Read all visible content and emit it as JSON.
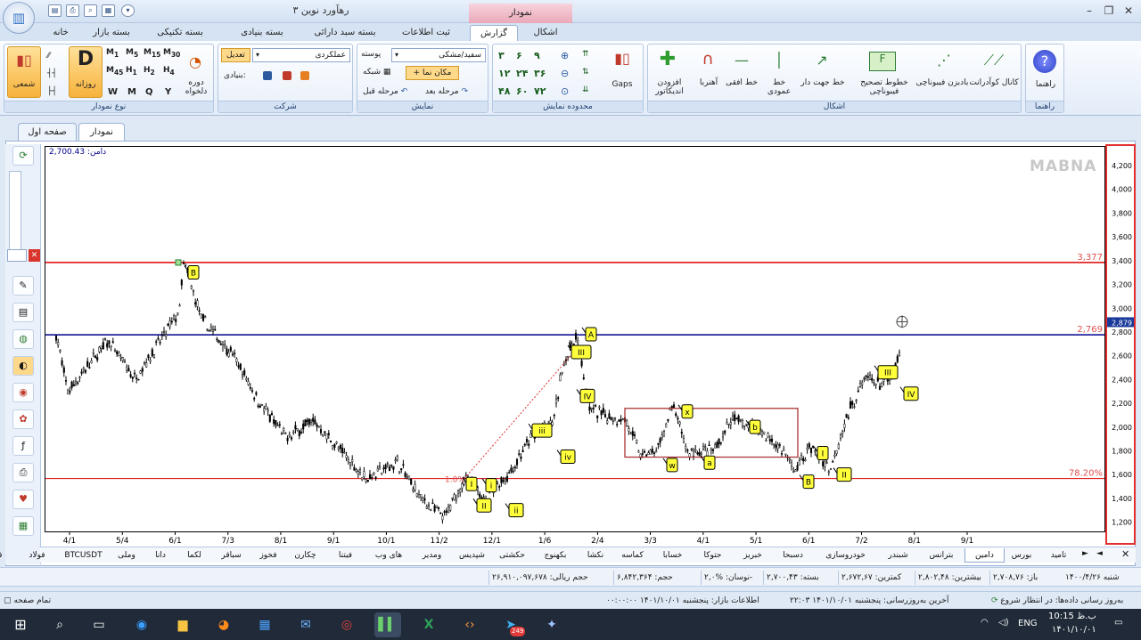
{
  "app": {
    "title": "رهآورد نوین ۳",
    "context_tab": "نمودار"
  },
  "ribbon_tabs": [
    "خانه",
    "بسته بازار",
    "بسته تکنیکی",
    "بسته بنیادی",
    "بسته سبد دارائی",
    "ثبت اطلاعات",
    "گزارش",
    "اشکال"
  ],
  "active_ribbon_tab": "گزارش",
  "groups": {
    "chart_type": {
      "label": "نوع نمودار",
      "candle": "شمعی",
      "daily": "روزانه",
      "daily_letter": "D",
      "periods": [
        "W",
        "M",
        "Q",
        "Y"
      ],
      "custom": "دوره دلخواه",
      "minutes": [
        "1",
        "5",
        "15",
        "30",
        "45",
        "1",
        "2",
        "4"
      ]
    },
    "company": {
      "label": "شرکت",
      "name": "عملکردی",
      "adjust": "تعدیل",
      "fundamental": "بنیادی:"
    },
    "display": {
      "label": "نمایش",
      "theme_label": "پوسته",
      "theme_value": "سفید/مشکی",
      "cursor": "مکان نما",
      "grid": "شبکه",
      "next": "مرحله بعد",
      "prev": "مرحله قبل"
    },
    "range": {
      "label": "محدوده نمایش",
      "gaps": "Gaps",
      "values": [
        "۳",
        "۶",
        "۹",
        "۱۲",
        "۲۴",
        "۳۶",
        "۴۸",
        "۶۰",
        "۷۲"
      ]
    },
    "shapes": {
      "label": "اشکال",
      "items": [
        "کانال کوآدرانت",
        "بادبزن فیبوناچی",
        "خطوط تصحیح فیبوناچی",
        "خط جهت دار",
        "خط عمودی",
        "خط افقی",
        "آهنربا",
        "افزودن اندیکاتور"
      ]
    },
    "help": {
      "label": "راهنما",
      "item": "راهنما"
    }
  },
  "doc_tabs": [
    "نمودار",
    "صفحه اول"
  ],
  "chart": {
    "watermark": "MABNA",
    "info_label": "دامن: 2,700.43",
    "price_lines": [
      {
        "value": 3377,
        "label": "3,377",
        "color": "#e00000"
      },
      {
        "value": 2769,
        "label": "2,769",
        "color": "#00008b"
      },
      {
        "value": 1560,
        "label": "78.20%",
        "color": "#e00000"
      }
    ],
    "fib_start_label": "1.0%",
    "current_price": "2,879",
    "y_ticks": [
      "4,200",
      "4,000",
      "3,800",
      "3,600",
      "3,400",
      "3,200",
      "3,000",
      "2,800",
      "2,600",
      "2,400",
      "2,200",
      "2,000",
      "1,800",
      "1,600",
      "1,400",
      "1,200"
    ],
    "x_ticks": [
      "4/1",
      "5/4",
      "6/1",
      "7/3",
      "8/1",
      "9/1",
      "10/1",
      "11/2",
      "12/1",
      "1/6",
      "2/4",
      "3/3",
      "4/1",
      "5/1",
      "6/1",
      "7/2",
      "8/1",
      "9/1"
    ],
    "y_range": [
      1100,
      4350
    ],
    "wave_labels": [
      "B",
      "A",
      "III",
      "IV",
      "iii",
      "iv",
      "I",
      "i",
      "ii",
      "II",
      "x",
      "w",
      "a",
      "b",
      "B",
      "I",
      "II",
      "III",
      "IV"
    ]
  },
  "symbol_tabs": [
    "تامید",
    "بورس",
    "دامین",
    "بترانس",
    "شبندر",
    "خودروسازی",
    "دسبحا",
    "خبریز",
    "حتوکا",
    "خسابا",
    "کماسه",
    "نکشا",
    "بکهنوج",
    "حکشتی",
    "شپدیس",
    "ومدیر",
    "های وب",
    "فیتنا",
    "چکارن",
    "فخوز",
    "سباقر",
    "لکما",
    "دانا",
    "وملی",
    "BTCUSDT",
    "فولاد",
    "فلزات اساسی"
  ],
  "active_symbol": "دامین",
  "info_bar": [
    "شنبه ۱۴۰۰/۴/۲۶",
    "باز: ۲,۷۰۸,۷۶",
    "بیشترین: ۲,۸۰۲,۴۸",
    "کمترین: ۲,۶۷۲,۶۷",
    "بسته: ۲,۷۰۰,۴۳",
    "نوسان: %۲,۰-",
    "حجم: ۶,۸۴۲,۳۶۴",
    "حجم ریالی: ۲۶,۹۱۰,۰۹۷,۶۷۸"
  ],
  "status": {
    "update_status": "به‌روز رسانی داده‌ها: در انتظار شروع",
    "last_update": "آخرین به‌روزرسانی: پنجشنبه ۱۴۰۱/۱۰/۰۱ ۲۲:۰۳",
    "market_info": "اطلاعات بازار: پنجشنبه ۱۴۰۱/۱۰/۰۱ ۰۰:۰۰:۰۰",
    "full_page": "تمام صفحه"
  },
  "taskbar": {
    "time": "10:15 ب.ظ",
    "date": "۱۴۰۱/۱۰/۰۱",
    "lang": "ENG",
    "badge": "249"
  }
}
